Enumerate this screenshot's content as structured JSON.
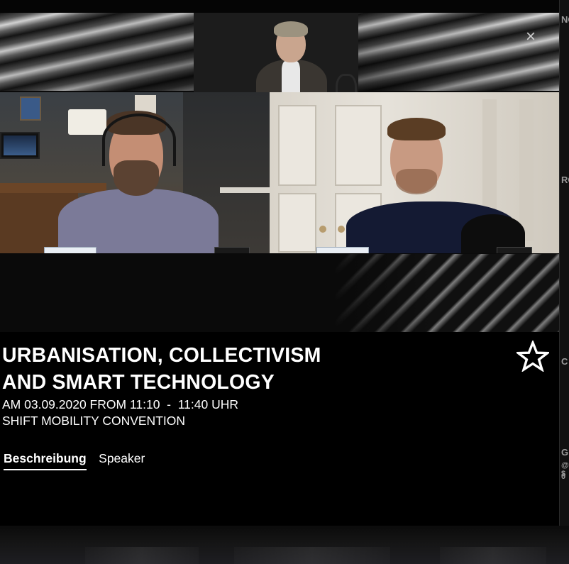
{
  "session": {
    "title_line1": "URBANISATION, COLLECTIVISM",
    "title_line2": "AND SMART TECHNOLOGY",
    "datetime": "AM 03.09.2020 FROM 11:10  -  11:40 UHR",
    "event": "SHIFT MOBILITY CONVENTION"
  },
  "tabs": [
    {
      "label": "Beschreibung",
      "active": true
    },
    {
      "label": "Speaker",
      "active": false
    }
  ],
  "controls": {
    "close_glyph": "×",
    "favorite_icon": "star-outline-icon"
  },
  "background_page": {
    "fragments": [
      "NG",
      "RO",
      "C",
      "G",
      "@ $",
      "0"
    ]
  },
  "colors": {
    "modal_bg": "#000000",
    "text": "#ffffff",
    "close": "#cfcfcf"
  }
}
